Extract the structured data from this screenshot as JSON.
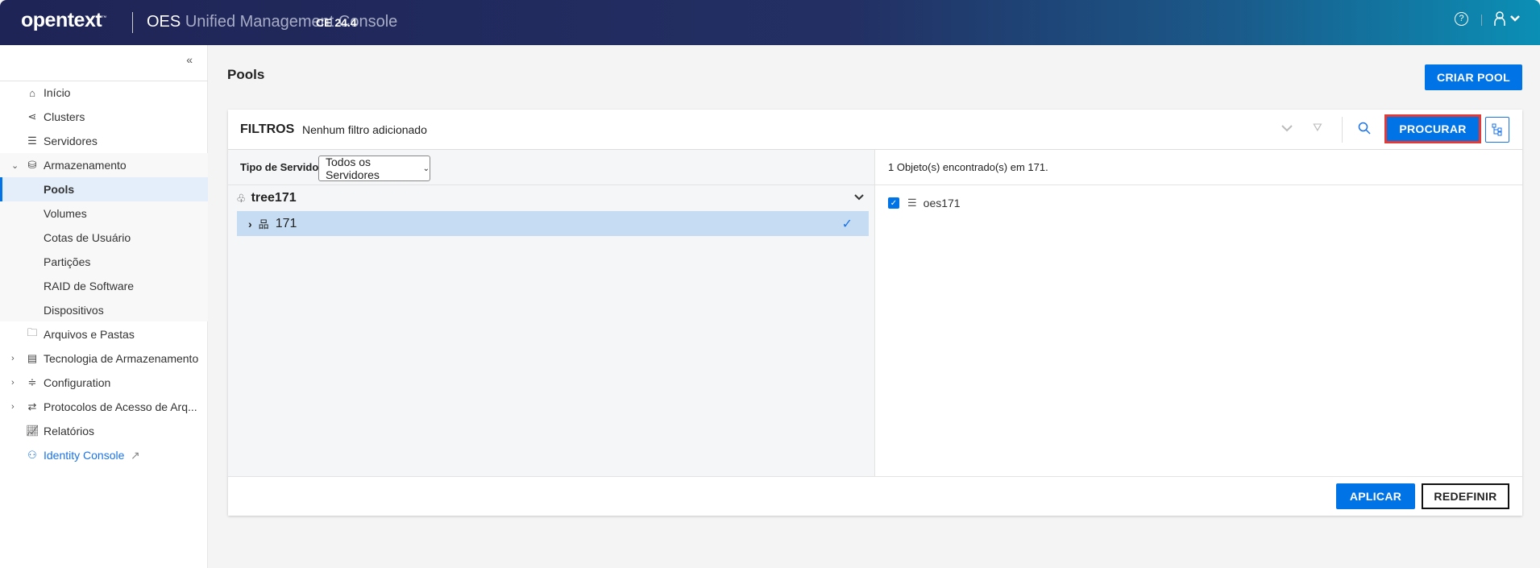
{
  "header": {
    "logo": "opentext",
    "logo_tm": "™",
    "app_prefix": "OES",
    "app_name": "Unified Management Console",
    "version": "CE 24.4",
    "help_icon": "help-circle-icon",
    "user_icon": "user-icon"
  },
  "sidebar": {
    "collapse": "«",
    "items": [
      {
        "label": "Início",
        "icon": "home-icon"
      },
      {
        "label": "Clusters",
        "icon": "share-icon"
      },
      {
        "label": "Servidores",
        "icon": "server-icon"
      },
      {
        "label": "Armazenamento",
        "icon": "database-icon"
      },
      {
        "label": "Pools"
      },
      {
        "label": "Volumes"
      },
      {
        "label": "Cotas de Usuário"
      },
      {
        "label": "Partições"
      },
      {
        "label": "RAID de Software"
      },
      {
        "label": "Dispositivos"
      },
      {
        "label": "Arquivos e Pastas",
        "icon": "folder-icon"
      },
      {
        "label": "Tecnologia de Armazenamento",
        "icon": "storage-tech-icon"
      },
      {
        "label": "Configuration",
        "icon": "sliders-icon"
      },
      {
        "label": "Protocolos de Acesso de Arq...",
        "icon": "arrows-exchange-icon"
      },
      {
        "label": "Relatórios",
        "icon": "chart-icon"
      },
      {
        "label": "Identity Console",
        "icon": "user-gear-icon"
      }
    ]
  },
  "page": {
    "title": "Pools",
    "create_button": "CRIAR POOL"
  },
  "filters": {
    "label": "FILTROS",
    "status": "Nenhum filtro adicionado",
    "search_button": "PROCURAR"
  },
  "left": {
    "server_type_label": "Tipo de Servidor",
    "server_type_value": "Todos os Servidores",
    "tree": {
      "root": "tree171",
      "child": "171"
    }
  },
  "right": {
    "result_text": "1 Objeto(s) encontrado(s) em 171.",
    "items": [
      {
        "name": "oes171",
        "checked": true
      }
    ]
  },
  "footer": {
    "apply": "APLICAR",
    "reset": "REDEFINIR"
  },
  "colors": {
    "accent": "#0073e7",
    "highlight": "#e53935"
  }
}
